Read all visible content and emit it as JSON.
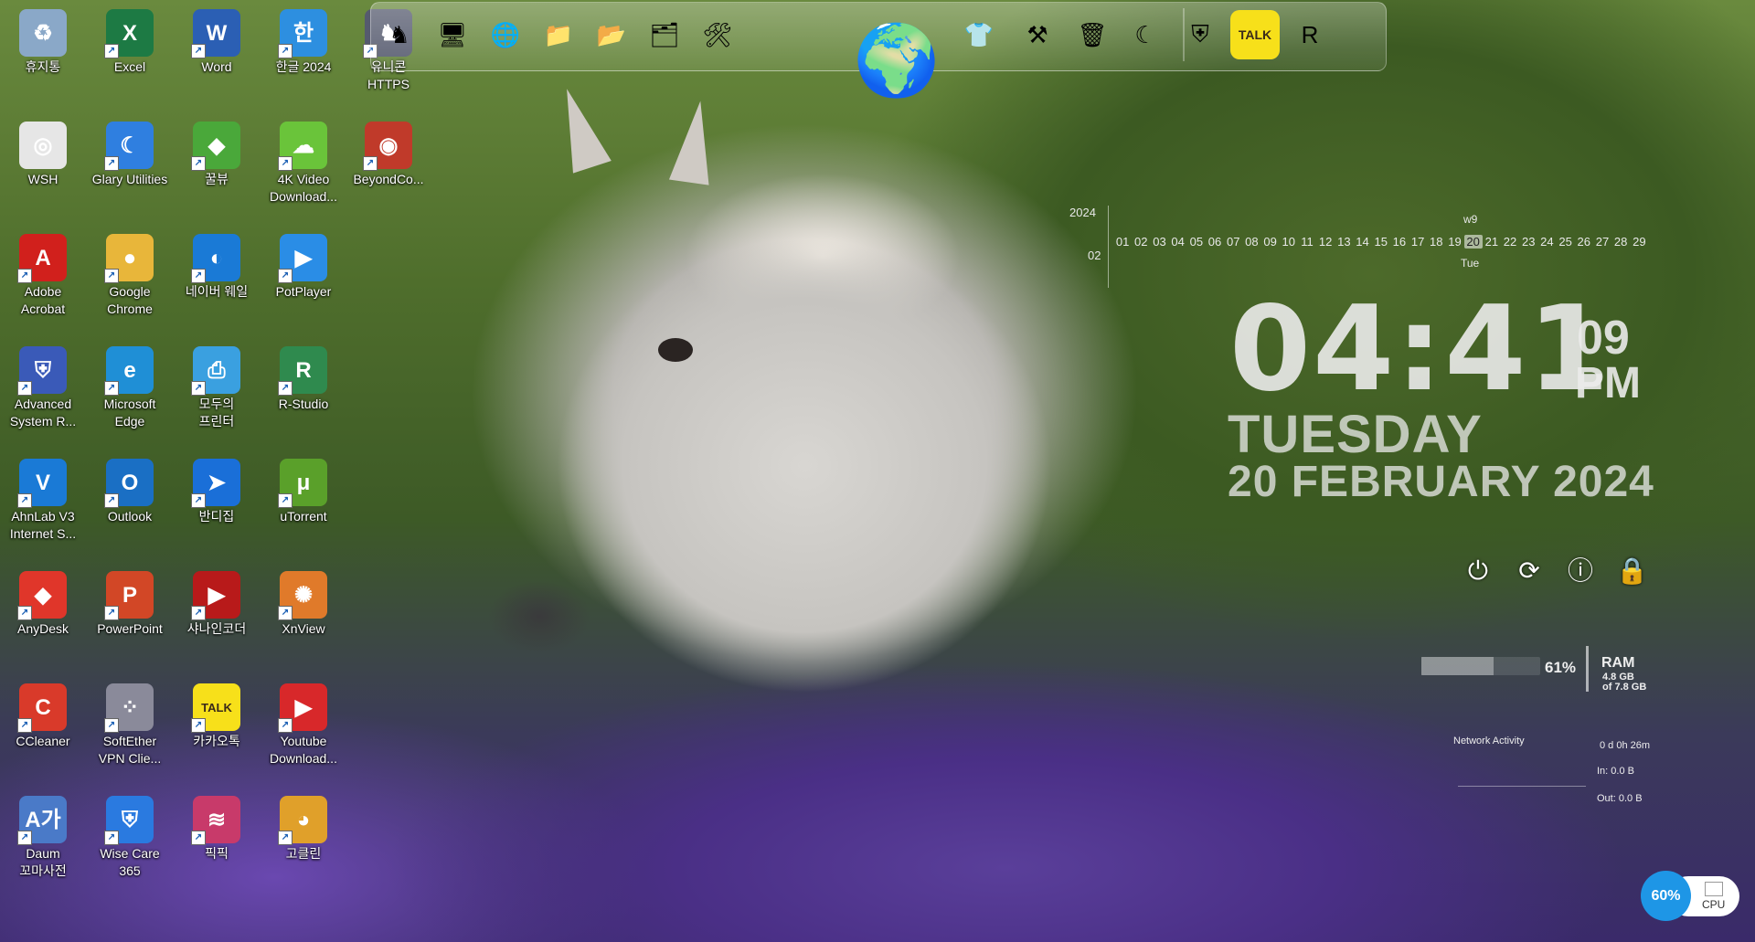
{
  "desktop_icons": [
    {
      "label": "휴지통",
      "icon": "recycle-bin-icon",
      "color": "#8aa8c8",
      "glyph": "♻"
    },
    {
      "label": "Excel",
      "icon": "excel-icon",
      "color": "#1d7a44",
      "glyph": "X"
    },
    {
      "label": "Word",
      "icon": "word-icon",
      "color": "#2b5fb4",
      "glyph": "W"
    },
    {
      "label": "한글 2024",
      "icon": "hangul-icon",
      "color": "#2d8fe0",
      "glyph": "한"
    },
    {
      "label": "유니콘\nHTTPS",
      "icon": "unicorn-https-icon",
      "color": "#555a6e",
      "glyph": "♞"
    },
    {
      "label": "WSH",
      "icon": "wsh-icon",
      "color": "#e6e6e6",
      "glyph": "◎"
    },
    {
      "label": "Glary Utilities",
      "icon": "glary-utilities-icon",
      "color": "#2f7fe0",
      "glyph": "☾"
    },
    {
      "label": "꿀뷰",
      "icon": "honeyview-icon",
      "color": "#4aa83a",
      "glyph": "◆"
    },
    {
      "label": "4K Video\nDownload...",
      "icon": "4k-video-downloader-icon",
      "color": "#6ac43a",
      "glyph": "☁"
    },
    {
      "label": "BeyondCo...",
      "icon": "beyond-compare-icon",
      "color": "#c03a2a",
      "glyph": "◉"
    },
    {
      "label": "Adobe\nAcrobat",
      "icon": "adobe-acrobat-icon",
      "color": "#d1201c",
      "glyph": "A"
    },
    {
      "label": "Google\nChrome",
      "icon": "chrome-icon",
      "color": "#e8b63a",
      "glyph": "●"
    },
    {
      "label": "네이버 웨일",
      "icon": "naver-whale-icon",
      "color": "#1a7ad6",
      "glyph": "◐"
    },
    {
      "label": "PotPlayer",
      "icon": "potplayer-icon",
      "color": "#2a8de6",
      "glyph": "▶"
    },
    {
      "label": "Advanced\nSystem R...",
      "icon": "advanced-system-repair-icon",
      "color": "#3a5ab8",
      "glyph": "⛨"
    },
    {
      "label": "Microsoft\nEdge",
      "icon": "edge-icon",
      "color": "#1f8fd6",
      "glyph": "e"
    },
    {
      "label": "모두의\n프린터",
      "icon": "printer-icon",
      "color": "#3aa0e0",
      "glyph": "⎙"
    },
    {
      "label": "R-Studio",
      "icon": "r-studio-icon",
      "color": "#2f8a4e",
      "glyph": "R"
    },
    {
      "label": "AhnLab V3\nInternet S...",
      "icon": "ahnlab-v3-icon",
      "color": "#1a7ad6",
      "glyph": "V"
    },
    {
      "label": "Outlook",
      "icon": "outlook-icon",
      "color": "#1a6fc4",
      "glyph": "O"
    },
    {
      "label": "반디집",
      "icon": "bandizip-icon",
      "color": "#1a6fd8",
      "glyph": "➤"
    },
    {
      "label": "uTorrent",
      "icon": "utorrent-icon",
      "color": "#5aa02a",
      "glyph": "μ"
    },
    {
      "label": "AnyDesk",
      "icon": "anydesk-icon",
      "color": "#e0362a",
      "glyph": "◆"
    },
    {
      "label": "PowerPoint",
      "icon": "powerpoint-icon",
      "color": "#d24726",
      "glyph": "P"
    },
    {
      "label": "샤나인코더",
      "icon": "shana-encoder-icon",
      "color": "#b81a1a",
      "glyph": "▶"
    },
    {
      "label": "XnView",
      "icon": "xnview-icon",
      "color": "#e07a2a",
      "glyph": "✺"
    },
    {
      "label": "CCleaner",
      "icon": "ccleaner-icon",
      "color": "#d93a2a",
      "glyph": "C"
    },
    {
      "label": "SoftEther\nVPN Clie...",
      "icon": "softether-vpn-icon",
      "color": "#8a8a9a",
      "glyph": "⁘"
    },
    {
      "label": "카카오톡",
      "icon": "kakaotalk-icon",
      "color": "#f7e01a",
      "glyph": "TALK"
    },
    {
      "label": "Youtube\nDownload...",
      "icon": "youtube-downloader-icon",
      "color": "#d8282a",
      "glyph": "▶"
    },
    {
      "label": "Daum\n꼬마사전",
      "icon": "daum-dictionary-icon",
      "color": "#4a7ac8",
      "glyph": "A가"
    },
    {
      "label": "Wise Care\n365",
      "icon": "wise-care-icon",
      "color": "#2a7ae0",
      "glyph": "⛨"
    },
    {
      "label": "픽픽",
      "icon": "picpick-icon",
      "color": "#c83a6a",
      "glyph": "≋"
    },
    {
      "label": "고클린",
      "icon": "goclean-icon",
      "color": "#e0a02a",
      "glyph": "◕"
    }
  ],
  "dock": {
    "items": [
      {
        "icon": "https-unicorn-icon",
        "glyph": "♞"
      },
      {
        "icon": "computer-icon",
        "glyph": "🖥"
      },
      {
        "icon": "network-globe-icon",
        "glyph": "🌐"
      },
      {
        "icon": "folder-icon",
        "glyph": "📁"
      },
      {
        "icon": "folder-green-icon",
        "glyph": "📂"
      },
      {
        "icon": "picture-folder-icon",
        "glyph": "🗂"
      },
      {
        "icon": "tools-icon",
        "glyph": "🛠"
      },
      {
        "icon": "internet-globe-icon",
        "glyph": "🌍"
      },
      {
        "icon": "tshirt-icon",
        "glyph": "👕"
      },
      {
        "icon": "settings-tools-icon",
        "glyph": "⚒"
      },
      {
        "icon": "recycle-bin-icon",
        "glyph": "🗑"
      },
      {
        "icon": "glary-moon-icon",
        "glyph": "☾"
      },
      {
        "icon": "wise-shield-icon",
        "glyph": "⛨"
      },
      {
        "icon": "kakaotalk-icon",
        "glyph": "TALK"
      },
      {
        "icon": "r-drive-icon",
        "glyph": "R"
      }
    ]
  },
  "calendar": {
    "year": "2024",
    "month": "02",
    "week": "w9",
    "day_of_week": "Tue",
    "today": "20",
    "days": [
      "01",
      "02",
      "03",
      "04",
      "05",
      "06",
      "07",
      "08",
      "09",
      "10",
      "11",
      "12",
      "13",
      "14",
      "15",
      "16",
      "17",
      "18",
      "19",
      "20",
      "21",
      "22",
      "23",
      "24",
      "25",
      "26",
      "27",
      "28",
      "29"
    ]
  },
  "clock": {
    "hours_minutes": "04:41",
    "seconds": "09",
    "ampm": "PM",
    "weekday": "TUESDAY",
    "date": "20 FEBRUARY  2024"
  },
  "power_controls": [
    {
      "icon": "power-icon",
      "glyph": "⏻"
    },
    {
      "icon": "restart-icon",
      "glyph": "⟳"
    },
    {
      "icon": "shutdown-info-icon",
      "glyph": "ⓘ"
    },
    {
      "icon": "lock-icon",
      "glyph": "🔒"
    }
  ],
  "ram": {
    "percent_text": "61%",
    "percent": 0.61,
    "label": "RAM",
    "used": "4.8 GB",
    "total": "of 7.8 GB"
  },
  "network": {
    "title": "Network Activity",
    "uptime": "0 d 0h 26m",
    "in": "In: 0.0 B",
    "out": "Out: 0.0 B"
  },
  "cpu": {
    "percent_text": "60%",
    "label": "CPU"
  },
  "colors": {
    "cpu_accent": "#1e96e6"
  }
}
